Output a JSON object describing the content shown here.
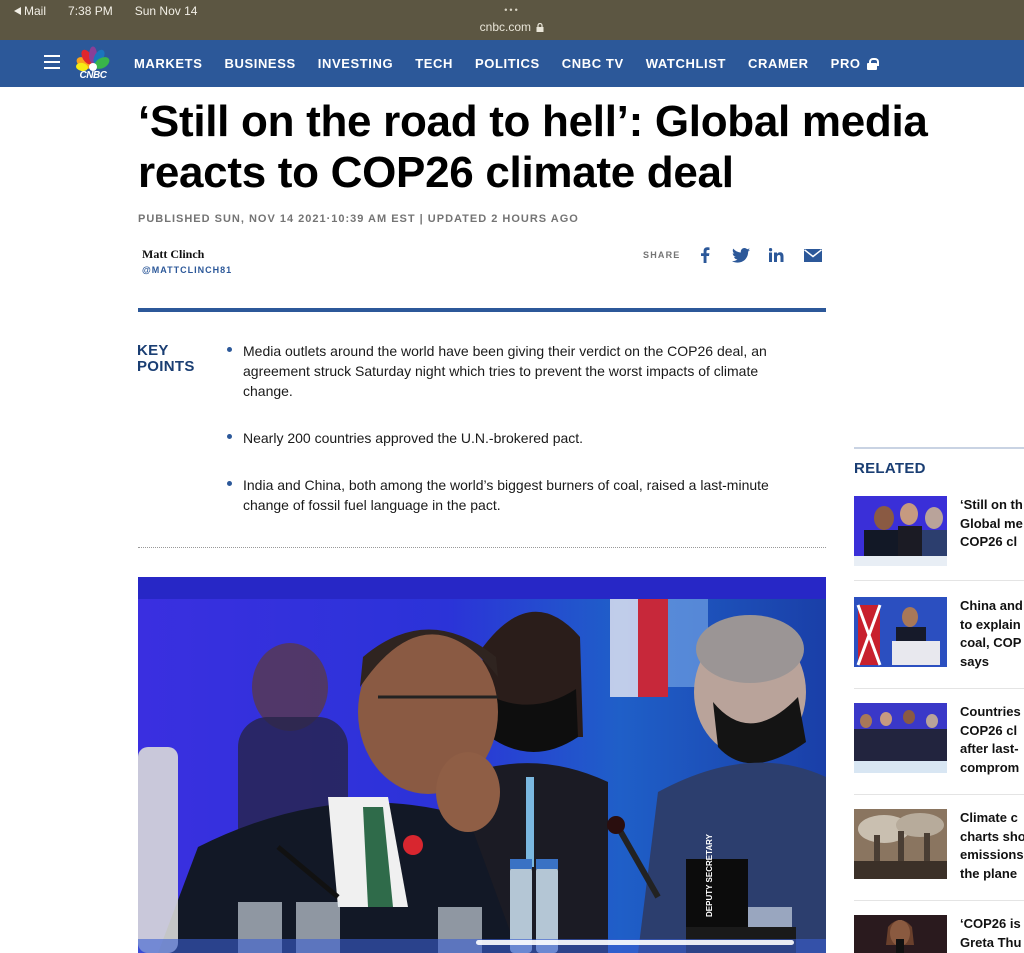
{
  "status_bar": {
    "back_label": "Mail",
    "time": "7:38 PM",
    "date": "Sun Nov 14",
    "dots": "•••",
    "url": "cnbc.com"
  },
  "nav": {
    "logo_text": "CNBC",
    "items": [
      "MARKETS",
      "BUSINESS",
      "INVESTING",
      "TECH",
      "POLITICS",
      "CNBC TV",
      "WATCHLIST",
      "CRAMER",
      "PRO"
    ]
  },
  "article": {
    "headline_line1": "‘Still on the road to hell’: Global media",
    "headline_line2": "reacts to COP26 climate deal",
    "published": "PUBLISHED SUN, NOV 14 2021·10:39 AM EST | UPDATED 2 HOURS AGO",
    "author_name": "Matt Clinch",
    "author_handle": "@MATTCLINCH81",
    "share_label": "SHARE",
    "key_points_label_1": "KEY",
    "key_points_label_2": "POINTS",
    "key_points": [
      "Media outlets around the world have been giving their verdict on the COP26 deal, an agreement struck Saturday night which tries to prevent the worst impacts of climate change.",
      "Nearly 200 countries approved the U.N.-brokered pact.",
      "India and China, both among the world’s biggest burners of coal, raised a last-minute change of fossil fuel language in the pact."
    ],
    "photo_placard": "DEPUTY SECRETARY"
  },
  "related": {
    "title": "RELATED",
    "items": [
      {
        "line1": "‘Still on th",
        "line2": "Global me",
        "line3": "COP26 cl",
        "line4": ""
      },
      {
        "line1": "China and",
        "line2": "to explain",
        "line3": "coal, COP",
        "line4": "says"
      },
      {
        "line1": "Countries",
        "line2": "COP26 cl",
        "line3": "after last-",
        "line4": "comprom"
      },
      {
        "line1": "Climate c",
        "line2": "charts sho",
        "line3": "emissions",
        "line4": "the plane"
      },
      {
        "line1": "‘COP26 is",
        "line2": "Greta Thu",
        "line3": "",
        "line4": ""
      }
    ]
  },
  "colors": {
    "nav_blue": "#2c5899",
    "status_bar": "#5c5642",
    "key_points_navy": "#1a3e73"
  }
}
